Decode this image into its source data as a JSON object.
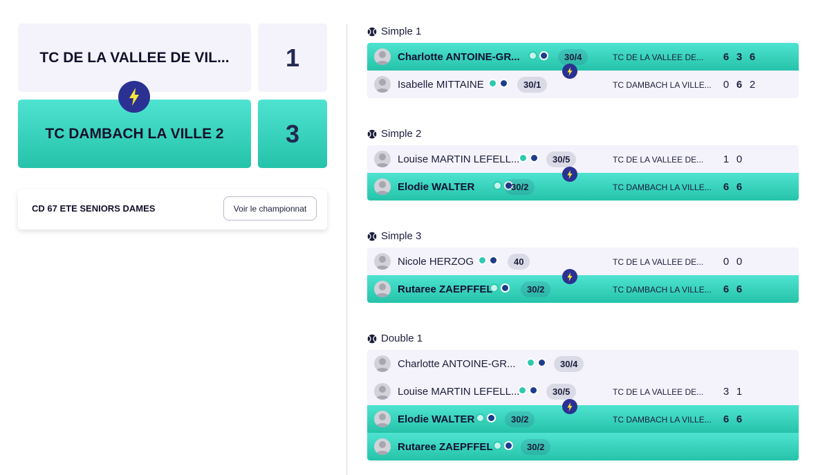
{
  "teams": [
    {
      "name": "TC DE LA VALLEE DE VIL...",
      "score": "1",
      "result": "lose"
    },
    {
      "name": "TC DAMBACH LA VILLE 2",
      "score": "3",
      "result": "win"
    }
  ],
  "championship": {
    "title": "CD 67 ETE SENIORS DAMES",
    "button_label": "Voir le championnat"
  },
  "colors": {
    "winner_start": "#4ee3d1",
    "winner_end": "#25c3a9",
    "loser_bg": "#f4f3fb",
    "bolt_bg": "#2b3192",
    "bolt_icon": "#f5e63b"
  },
  "matches": [
    {
      "title": "Simple 1",
      "rows": [
        {
          "player": "Charlotte ANTOINE-GR...",
          "rank": "30/4",
          "club": "TC DE LA VALLEE DE...",
          "sets": [
            "6",
            "3",
            "6"
          ],
          "bold_sets": [
            true,
            true,
            true
          ],
          "result": "win"
        },
        {
          "player": "Isabelle MITTAINE",
          "rank": "30/1",
          "club": "TC DAMBACH LA VILLE...",
          "sets": [
            "0",
            "6",
            "2"
          ],
          "bold_sets": [
            false,
            true,
            false
          ],
          "result": "lose"
        }
      ]
    },
    {
      "title": "Simple 2",
      "rows": [
        {
          "player": "Louise MARTIN LEFELL...",
          "rank": "30/5",
          "club": "TC DE LA VALLEE DE...",
          "sets": [
            "1",
            "0"
          ],
          "bold_sets": [
            false,
            false
          ],
          "result": "lose"
        },
        {
          "player": "Elodie WALTER",
          "rank": "30/2",
          "club": "TC DAMBACH LA VILLE...",
          "sets": [
            "6",
            "6"
          ],
          "bold_sets": [
            true,
            true
          ],
          "result": "win"
        }
      ]
    },
    {
      "title": "Simple 3",
      "rows": [
        {
          "player": "Nicole HERZOG",
          "rank": "40",
          "club": "TC DE LA VALLEE DE...",
          "sets": [
            "0",
            "0"
          ],
          "bold_sets": [
            false,
            false
          ],
          "result": "lose"
        },
        {
          "player": "Rutaree ZAEPFFEL",
          "rank": "30/2",
          "club": "TC DAMBACH LA VILLE...",
          "sets": [
            "6",
            "6"
          ],
          "bold_sets": [
            true,
            true
          ],
          "result": "win"
        }
      ]
    },
    {
      "title": "Double 1",
      "rows": [
        {
          "player": "Charlotte ANTOINE-GR...",
          "rank": "30/4",
          "club": "",
          "sets": [],
          "bold_sets": [],
          "result": "lose"
        },
        {
          "player": "Louise MARTIN LEFELL...",
          "rank": "30/5",
          "club": "TC DE LA VALLEE DE...",
          "sets": [
            "3",
            "1"
          ],
          "bold_sets": [
            false,
            false
          ],
          "result": "lose"
        },
        {
          "player": "Elodie WALTER",
          "rank": "30/2",
          "club": "TC DAMBACH LA VILLE...",
          "sets": [
            "6",
            "6"
          ],
          "bold_sets": [
            true,
            true
          ],
          "result": "win"
        },
        {
          "player": "Rutaree ZAEPFFEL",
          "rank": "30/2",
          "club": "",
          "sets": [],
          "bold_sets": [],
          "result": "win"
        }
      ]
    }
  ]
}
